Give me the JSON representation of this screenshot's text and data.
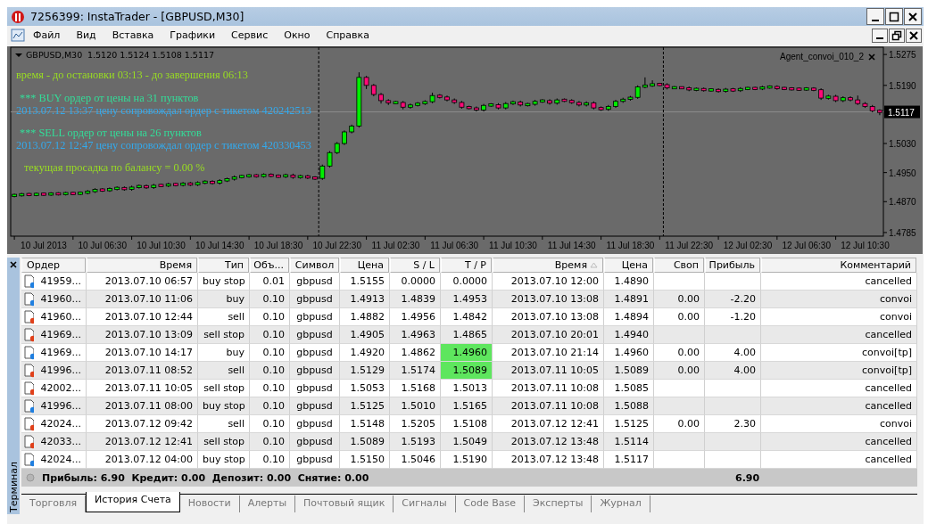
{
  "window": {
    "title": "7256399: InstaTrader - [GBPUSD,M30]"
  },
  "menu": [
    "Файл",
    "Вид",
    "Вставка",
    "Графики",
    "Сервис",
    "Окно",
    "Справка"
  ],
  "chart": {
    "symbol": "GBPUSD,M30",
    "ohlc": "1.5120 1.5124 1.5108 1.5117",
    "expert": "Agent_convoi_010_2",
    "messages": [
      {
        "text": "время - до остановки 03:13 - до завершения 06:13",
        "color": "#99dd22"
      },
      {
        "text": "*** BUY ордер от цены на 31 пунктов",
        "color": "#33dd99"
      },
      {
        "text": "2013.07.12 13:37 цену сопровождал ордер с тикетом  420242513",
        "color": "#33aaee"
      },
      {
        "text": "*** SELL ордер от цены на 26 пунктов",
        "color": "#33dd99"
      },
      {
        "text": "2013.07.12 12:47 цену сопровождал ордер с тикетом  420330453",
        "color": "#33aaee"
      },
      {
        "text": "текущая просадка по балансу =  0.00 %",
        "color": "#99dd22"
      }
    ],
    "chart_data": {
      "type": "candlestick",
      "ylim": [
        1.4775,
        1.5295
      ],
      "categories": [
        null,
        null,
        null,
        null,
        "10 Jul 2013",
        null,
        null,
        null,
        null,
        null,
        null,
        null,
        "10 Jul 06:30",
        null,
        null,
        null,
        null,
        null,
        null,
        null,
        "10 Jul 10:30",
        null,
        null,
        null,
        null,
        null,
        null,
        null,
        "10 Jul 14:30",
        null,
        null,
        null,
        null,
        null,
        null,
        null,
        "10 Jul 18:30",
        null,
        null,
        null,
        null,
        null,
        null,
        null,
        "10 Jul 22:30",
        null,
        null,
        null,
        null,
        null,
        null,
        null,
        "11 Jul 02:30",
        null,
        null,
        null,
        null,
        null,
        null,
        null,
        "11 Jul 06:30",
        null,
        null,
        null,
        null,
        null,
        null,
        null,
        "11 Jul 10:30",
        null,
        null,
        null,
        null,
        null,
        null,
        null,
        "11 Jul 14:30",
        null,
        null,
        null,
        null,
        null,
        null,
        null,
        "11 Jul 18:30",
        null,
        null,
        null,
        null,
        null,
        null,
        null,
        "11 Jul 22:30",
        null,
        null,
        null,
        null,
        null,
        null,
        null,
        "12 Jul 02:30",
        null,
        null,
        null,
        null,
        null,
        null,
        null,
        "12 Jul 06:30",
        null,
        null,
        null,
        null,
        null,
        null,
        null,
        "12 Jul 10:30",
        null,
        null
      ],
      "ref_lines": [
        {
          "axis": "y",
          "value": 1.5117,
          "label": "1.5117"
        }
      ],
      "yticks": [
        {
          "value": 1.5275,
          "label": "1.5275"
        },
        {
          "value": 1.519,
          "label": "1.5190"
        },
        {
          "value": 1.503,
          "label": "1.5030"
        },
        {
          "value": 1.495,
          "label": "1.4950"
        },
        {
          "value": 1.487,
          "label": "1.4870"
        },
        {
          "value": 1.4785,
          "label": "1.4785"
        }
      ],
      "ohlc": [
        [
          1.4886,
          1.4892,
          1.4882,
          1.4888
        ],
        [
          1.4888,
          1.4894,
          1.4884,
          1.489
        ],
        [
          1.489,
          1.4894,
          1.4885,
          1.4889
        ],
        [
          1.4889,
          1.4895,
          1.4885,
          1.4891
        ],
        [
          1.4891,
          1.4895,
          1.4886,
          1.489
        ],
        [
          1.489,
          1.4896,
          1.4886,
          1.4892
        ],
        [
          1.4892,
          1.4896,
          1.4887,
          1.4891
        ],
        [
          1.4891,
          1.4897,
          1.4887,
          1.4893
        ],
        [
          1.4893,
          1.4897,
          1.4888,
          1.4892
        ],
        [
          1.4892,
          1.4898,
          1.4888,
          1.4894
        ],
        [
          1.4894,
          1.4902,
          1.489,
          1.4898
        ],
        [
          1.4898,
          1.4907,
          1.4894,
          1.4903
        ],
        [
          1.4903,
          1.4907,
          1.4897,
          1.4901
        ],
        [
          1.4901,
          1.4909,
          1.4897,
          1.4905
        ],
        [
          1.4905,
          1.4912,
          1.4901,
          1.4908
        ],
        [
          1.4908,
          1.4912,
          1.49,
          1.4904
        ],
        [
          1.4904,
          1.4914,
          1.49,
          1.491
        ],
        [
          1.491,
          1.4917,
          1.4906,
          1.4913
        ],
        [
          1.4913,
          1.4917,
          1.4905,
          1.4909
        ],
        [
          1.4909,
          1.4919,
          1.4905,
          1.4915
        ],
        [
          1.4915,
          1.4919,
          1.491,
          1.4914
        ],
        [
          1.4914,
          1.4922,
          1.491,
          1.4918
        ],
        [
          1.4918,
          1.4922,
          1.4912,
          1.4916
        ],
        [
          1.4916,
          1.4924,
          1.4912,
          1.492
        ],
        [
          1.492,
          1.4924,
          1.4913,
          1.4917
        ],
        [
          1.4917,
          1.4926,
          1.4913,
          1.4922
        ],
        [
          1.4922,
          1.4929,
          1.4918,
          1.4925
        ],
        [
          1.4925,
          1.4929,
          1.4917,
          1.4921
        ],
        [
          1.4921,
          1.4932,
          1.4917,
          1.4928
        ],
        [
          1.4928,
          1.4936,
          1.4924,
          1.4932
        ],
        [
          1.4932,
          1.4942,
          1.4928,
          1.4938
        ],
        [
          1.4938,
          1.4944,
          1.4934,
          1.494
        ],
        [
          1.494,
          1.4946,
          1.4936,
          1.4942
        ],
        [
          1.4942,
          1.4946,
          1.4936,
          1.494
        ],
        [
          1.494,
          1.4948,
          1.4936,
          1.4944
        ],
        [
          1.4944,
          1.4948,
          1.4937,
          1.4941
        ],
        [
          1.4941,
          1.4945,
          1.4935,
          1.4939
        ],
        [
          1.4939,
          1.4947,
          1.4935,
          1.4943
        ],
        [
          1.4943,
          1.4947,
          1.4933,
          1.4937
        ],
        [
          1.4937,
          1.4944,
          1.4933,
          1.494
        ],
        [
          1.494,
          1.4944,
          1.4932,
          1.4936
        ],
        [
          1.4936,
          1.494,
          1.493,
          1.4934
        ],
        [
          1.4934,
          1.4972,
          1.493,
          1.4968
        ],
        [
          1.4968,
          1.5009,
          1.4964,
          1.5005
        ],
        [
          1.5005,
          1.5034,
          1.5001,
          1.503
        ],
        [
          1.503,
          1.5066,
          1.5026,
          1.5062
        ],
        [
          1.5062,
          1.5082,
          1.5058,
          1.5078
        ],
        [
          1.5078,
          1.5226,
          1.5074,
          1.5212
        ],
        [
          1.5212,
          1.5216,
          1.518,
          1.519
        ],
        [
          1.519,
          1.5194,
          1.516,
          1.5165
        ],
        [
          1.5165,
          1.5169,
          1.514,
          1.5148
        ],
        [
          1.5148,
          1.5152,
          1.5136,
          1.5142
        ],
        [
          1.5142,
          1.5147,
          1.5138,
          1.5143
        ],
        [
          1.5143,
          1.5147,
          1.5124,
          1.513
        ],
        [
          1.513,
          1.514,
          1.5126,
          1.5136
        ],
        [
          1.5136,
          1.5144,
          1.5132,
          1.514
        ],
        [
          1.514,
          1.5149,
          1.5136,
          1.5145
        ],
        [
          1.5145,
          1.517,
          1.5141,
          1.5162
        ],
        [
          1.5162,
          1.5166,
          1.5154,
          1.5158
        ],
        [
          1.5158,
          1.5162,
          1.5146,
          1.515
        ],
        [
          1.515,
          1.5154,
          1.5139,
          1.5143
        ],
        [
          1.5143,
          1.5147,
          1.5126,
          1.513
        ],
        [
          1.513,
          1.5134,
          1.5124,
          1.5128
        ],
        [
          1.5128,
          1.5132,
          1.5118,
          1.5122
        ],
        [
          1.5122,
          1.5139,
          1.5118,
          1.5135
        ],
        [
          1.5135,
          1.5141,
          1.5131,
          1.5137
        ],
        [
          1.5137,
          1.5141,
          1.5124,
          1.5128
        ],
        [
          1.5128,
          1.5144,
          1.5124,
          1.514
        ],
        [
          1.514,
          1.5148,
          1.5136,
          1.5144
        ],
        [
          1.5144,
          1.5148,
          1.5132,
          1.5136
        ],
        [
          1.5136,
          1.5142,
          1.5132,
          1.5138
        ],
        [
          1.5138,
          1.515,
          1.5134,
          1.5146
        ],
        [
          1.5146,
          1.5152,
          1.5142,
          1.5148
        ],
        [
          1.5148,
          1.5152,
          1.5137,
          1.5141
        ],
        [
          1.5141,
          1.5154,
          1.5137,
          1.515
        ],
        [
          1.515,
          1.5154,
          1.5144,
          1.5148
        ],
        [
          1.5148,
          1.5152,
          1.5139,
          1.5143
        ],
        [
          1.5143,
          1.5147,
          1.5132,
          1.5136
        ],
        [
          1.5136,
          1.5146,
          1.5132,
          1.5142
        ],
        [
          1.5142,
          1.5146,
          1.5124,
          1.5128
        ],
        [
          1.5128,
          1.5132,
          1.512,
          1.5124
        ],
        [
          1.5124,
          1.5136,
          1.512,
          1.5132
        ],
        [
          1.5132,
          1.515,
          1.5128,
          1.5146
        ],
        [
          1.5146,
          1.5156,
          1.5142,
          1.5152
        ],
        [
          1.5152,
          1.5161,
          1.5148,
          1.5157
        ],
        [
          1.5157,
          1.519,
          1.5153,
          1.5186
        ],
        [
          1.5186,
          1.5212,
          1.5182,
          1.519
        ],
        [
          1.519,
          1.5204,
          1.5186,
          1.5193
        ],
        [
          1.5193,
          1.5197,
          1.5188,
          1.5192
        ],
        [
          1.5192,
          1.5196,
          1.5179,
          1.5183
        ],
        [
          1.5183,
          1.5188,
          1.518,
          1.5184
        ],
        [
          1.5184,
          1.5187,
          1.518,
          1.5183
        ],
        [
          1.5183,
          1.5187,
          1.5174,
          1.5178
        ],
        [
          1.5178,
          1.5184,
          1.5174,
          1.518
        ],
        [
          1.518,
          1.5184,
          1.5173,
          1.5177
        ],
        [
          1.5177,
          1.5182,
          1.5173,
          1.5178
        ],
        [
          1.5178,
          1.5182,
          1.517,
          1.5174
        ],
        [
          1.5174,
          1.5183,
          1.517,
          1.5179
        ],
        [
          1.5179,
          1.5183,
          1.5172,
          1.5176
        ],
        [
          1.5176,
          1.5185,
          1.5172,
          1.5181
        ],
        [
          1.5181,
          1.5186,
          1.5177,
          1.5182
        ],
        [
          1.5182,
          1.5186,
          1.5177,
          1.5181
        ],
        [
          1.5181,
          1.5189,
          1.5177,
          1.5185
        ],
        [
          1.5185,
          1.519,
          1.5181,
          1.5186
        ],
        [
          1.5186,
          1.519,
          1.5178,
          1.5182
        ],
        [
          1.5182,
          1.5186,
          1.5177,
          1.5181
        ],
        [
          1.5181,
          1.5185,
          1.5176,
          1.518
        ],
        [
          1.518,
          1.5184,
          1.5175,
          1.5179
        ],
        [
          1.5179,
          1.5185,
          1.5175,
          1.5181
        ],
        [
          1.5181,
          1.5185,
          1.5174,
          1.5178
        ],
        [
          1.5178,
          1.5182,
          1.515,
          1.5155
        ],
        [
          1.5155,
          1.5164,
          1.5151,
          1.516
        ],
        [
          1.516,
          1.5164,
          1.5144,
          1.5148
        ],
        [
          1.5148,
          1.516,
          1.5144,
          1.5156
        ],
        [
          1.5156,
          1.516,
          1.5146,
          1.515
        ],
        [
          1.515,
          1.5162,
          1.5136,
          1.514
        ],
        [
          1.514,
          1.5144,
          1.5128,
          1.5132
        ],
        [
          1.5132,
          1.5136,
          1.5116,
          1.512
        ],
        [
          1.512,
          1.5124,
          1.5108,
          1.5117
        ]
      ]
    }
  },
  "terminal": {
    "title": "Терминал",
    "columns": [
      {
        "label": "Ордер",
        "sorted": false
      },
      {
        "label": "Время",
        "sorted": false
      },
      {
        "label": "Тип",
        "sorted": false
      },
      {
        "label": "Объ...",
        "sorted": false
      },
      {
        "label": "Символ",
        "sorted": false
      },
      {
        "label": "Цена",
        "sorted": false
      },
      {
        "label": "S / L",
        "sorted": false
      },
      {
        "label": "T / P",
        "sorted": false
      },
      {
        "label": "Время",
        "sorted": true
      },
      {
        "label": "Цена",
        "sorted": false
      },
      {
        "label": "Своп",
        "sorted": false
      },
      {
        "label": "Прибыль",
        "sorted": false
      },
      {
        "label": "Комментарий",
        "sorted": false
      }
    ],
    "rows": [
      {
        "color": "#1f7fe0",
        "tp_hit": false,
        "order": "41959...",
        "open_time": "2013.07.10 06:57",
        "type": "buy stop",
        "volume": "0.01",
        "symbol": "gbpusd",
        "open_price": "1.5155",
        "sl": "0.0000",
        "tp": "0.0000",
        "close_time": "2013.07.10 12:00",
        "close_price": "1.4890",
        "comment": "cancelled"
      },
      {
        "color": "#1f7fe0",
        "tp_hit": false,
        "order": "41960...",
        "open_time": "2013.07.10 11:06",
        "type": "buy",
        "volume": "0.10",
        "symbol": "gbpusd",
        "open_price": "1.4913",
        "sl": "1.4839",
        "tp": "1.4953",
        "close_time": "2013.07.10 13:08",
        "close_price": "1.4891",
        "swap": "0.00",
        "profit": "-2.20",
        "comment": "convoi"
      },
      {
        "color": "#e0401a",
        "tp_hit": false,
        "order": "41960...",
        "open_time": "2013.07.10 12:44",
        "type": "sell",
        "volume": "0.10",
        "symbol": "gbpusd",
        "open_price": "1.4882",
        "sl": "1.4956",
        "tp": "1.4842",
        "close_time": "2013.07.10 13:08",
        "close_price": "1.4894",
        "swap": "0.00",
        "profit": "-1.20",
        "comment": "convoi"
      },
      {
        "color": "#e0401a",
        "tp_hit": false,
        "order": "41969...",
        "open_time": "2013.07.10 13:09",
        "type": "sell stop",
        "volume": "0.10",
        "symbol": "gbpusd",
        "open_price": "1.4905",
        "sl": "1.4963",
        "tp": "1.4865",
        "close_time": "2013.07.10 20:01",
        "close_price": "1.4940",
        "comment": "cancelled"
      },
      {
        "color": "#1f7fe0",
        "tp_hit": true,
        "order": "41969...",
        "open_time": "2013.07.10 14:17",
        "type": "buy",
        "volume": "0.10",
        "symbol": "gbpusd",
        "open_price": "1.4920",
        "sl": "1.4862",
        "tp": "1.4960",
        "close_time": "2013.07.10 21:14",
        "close_price": "1.4960",
        "swap": "0.00",
        "profit": "4.00",
        "comment": "convoi[tp]"
      },
      {
        "color": "#e0401a",
        "tp_hit": true,
        "order": "41996...",
        "open_time": "2013.07.11 08:52",
        "type": "sell",
        "volume": "0.10",
        "symbol": "gbpusd",
        "open_price": "1.5129",
        "sl": "1.5174",
        "tp": "1.5089",
        "close_time": "2013.07.11 10:05",
        "close_price": "1.5089",
        "swap": "0.00",
        "profit": "4.00",
        "comment": "convoi[tp]"
      },
      {
        "color": "#e0401a",
        "tp_hit": false,
        "order": "42002...",
        "open_time": "2013.07.11 10:05",
        "type": "sell stop",
        "volume": "0.10",
        "symbol": "gbpusd",
        "open_price": "1.5053",
        "sl": "1.5168",
        "tp": "1.5013",
        "close_time": "2013.07.11 10:08",
        "close_price": "1.5085",
        "comment": "cancelled"
      },
      {
        "color": "#1f7fe0",
        "tp_hit": false,
        "order": "41996...",
        "open_time": "2013.07.11 08:00",
        "type": "buy stop",
        "volume": "0.10",
        "symbol": "gbpusd",
        "open_price": "1.5125",
        "sl": "1.5010",
        "tp": "1.5165",
        "close_time": "2013.07.11 10:08",
        "close_price": "1.5088",
        "comment": "cancelled"
      },
      {
        "color": "#e0401a",
        "tp_hit": false,
        "order": "42024...",
        "open_time": "2013.07.12 09:42",
        "type": "sell",
        "volume": "0.10",
        "symbol": "gbpusd",
        "open_price": "1.5148",
        "sl": "1.5205",
        "tp": "1.5108",
        "close_time": "2013.07.12 12:41",
        "close_price": "1.5125",
        "swap": "0.00",
        "profit": "2.30",
        "comment": "convoi"
      },
      {
        "color": "#e0401a",
        "tp_hit": false,
        "order": "42033...",
        "open_time": "2013.07.12 12:41",
        "type": "sell stop",
        "volume": "0.10",
        "symbol": "gbpusd",
        "open_price": "1.5089",
        "sl": "1.5193",
        "tp": "1.5049",
        "close_time": "2013.07.12 13:48",
        "close_price": "1.5114",
        "comment": "cancelled"
      },
      {
        "color": "#1f7fe0",
        "tp_hit": false,
        "order": "42024...",
        "open_time": "2013.07.12 04:00",
        "type": "buy stop",
        "volume": "0.10",
        "symbol": "gbpusd",
        "open_price": "1.5150",
        "sl": "1.5046",
        "tp": "1.5190",
        "close_time": "2013.07.12 13:48",
        "close_price": "1.5117",
        "comment": "cancelled"
      }
    ],
    "summary": {
      "text": "Прибыль: 6.90  Кредит: 0.00  Депозит: 0.00  Снятие: 0.00",
      "total_profit": "6.90"
    },
    "tabs": [
      {
        "label": "Торговля",
        "selected": false
      },
      {
        "label": "История Счета",
        "selected": true
      },
      {
        "label": "Новости",
        "selected": false
      },
      {
        "label": "Алерты",
        "selected": false
      },
      {
        "label": "Почтовый ящик",
        "selected": false
      },
      {
        "label": "Сигналы",
        "selected": false
      },
      {
        "label": "Code Base",
        "selected": false
      },
      {
        "label": "Эксперты",
        "selected": false
      },
      {
        "label": "Журнал",
        "selected": false
      }
    ]
  }
}
